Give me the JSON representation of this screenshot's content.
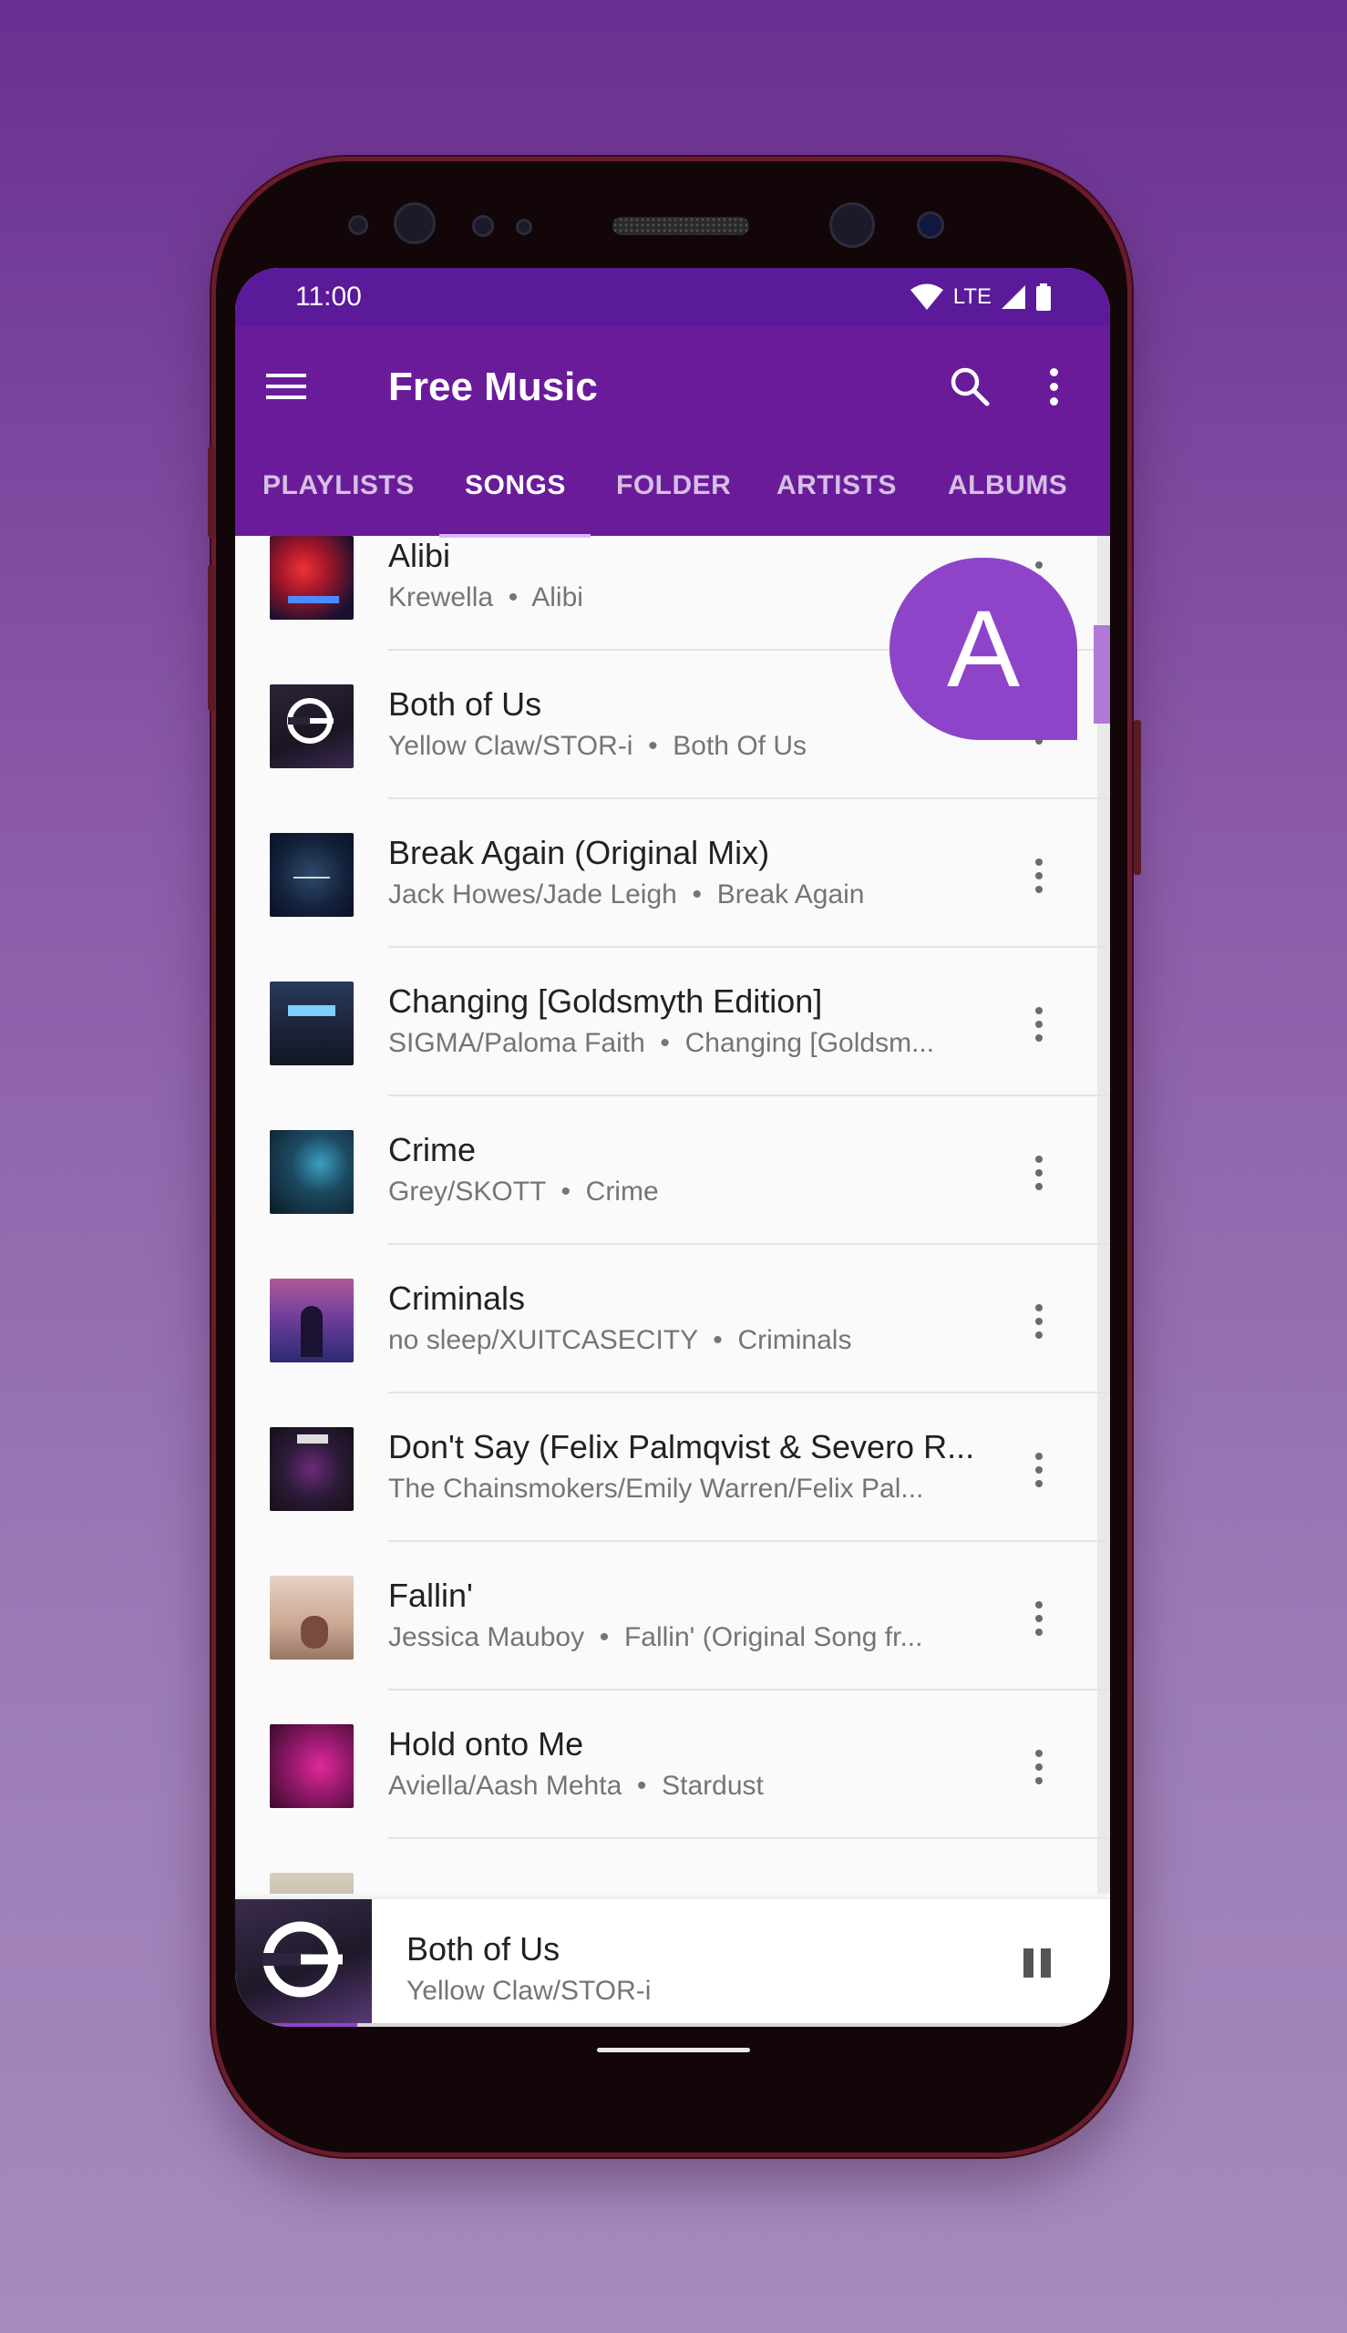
{
  "status_bar": {
    "time": "11:00",
    "network": "LTE"
  },
  "app_bar": {
    "title": "Free Music"
  },
  "tabs": [
    {
      "label": "PLAYLISTS",
      "active": false
    },
    {
      "label": "SONGS",
      "active": true
    },
    {
      "label": "FOLDER",
      "active": false
    },
    {
      "label": "ARTISTS",
      "active": false
    },
    {
      "label": "ALBUMS",
      "active": false
    }
  ],
  "fast_scroll": {
    "letter": "A"
  },
  "songs": [
    {
      "title": "Alibi",
      "artist": "Krewella",
      "album": "Alibi"
    },
    {
      "title": "Both of Us",
      "artist": "Yellow Claw/STOR-i",
      "album": "Both Of Us"
    },
    {
      "title": "Break Again (Original Mix)",
      "artist": "Jack Howes/Jade Leigh",
      "album": "Break Again"
    },
    {
      "title": "Changing [Goldsmyth Edition]",
      "artist": "SIGMA/Paloma Faith",
      "album": "Changing [Goldsm..."
    },
    {
      "title": "Crime",
      "artist": "Grey/SKOTT",
      "album": "Crime"
    },
    {
      "title": "Criminals",
      "artist": "no sleep/XUITCASECITY",
      "album": "Criminals"
    },
    {
      "title": "Don't Say (Felix Palmqvist & Severo R...",
      "artist": "The Chainsmokers/Emily Warren/Felix Pal...",
      "album": ""
    },
    {
      "title": "Fallin'",
      "artist": "Jessica Mauboy",
      "album": "Fallin' (Original Song fr..."
    },
    {
      "title": "Hold onto Me",
      "artist": "Aviella/Aash Mehta",
      "album": "Stardust"
    }
  ],
  "now_playing": {
    "title": "Both of Us",
    "artist": "Yellow Claw/STOR-i",
    "progress": 0.14
  },
  "colors": {
    "primary": "#6a1b9a",
    "status_bar": "#5a1a9a",
    "accent": "#8e44c8"
  }
}
